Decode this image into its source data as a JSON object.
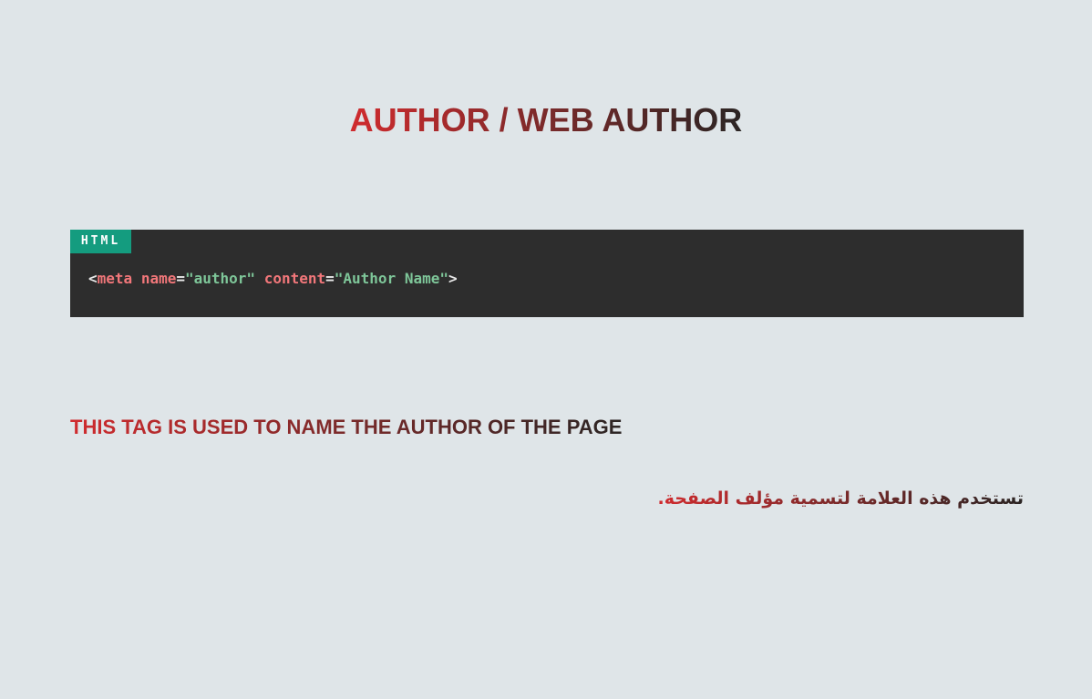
{
  "page": {
    "title": "AUTHOR / WEB AUTHOR"
  },
  "code_block": {
    "language_label": "HTML",
    "tokens": {
      "open": "<",
      "tag": "meta",
      "space1": " ",
      "attr1_name": "name",
      "eq1": "=",
      "attr1_value": "\"author\"",
      "space2": " ",
      "attr2_name": "content",
      "eq2": "=",
      "attr2_value": "\"Author Name\"",
      "close": ">"
    }
  },
  "description": {
    "english": "THIS TAG IS USED TO NAME THE AUTHOR OF THE PAGE",
    "arabic": "تستخدم هذه العلامة لتسمية مؤلف الصفحة."
  },
  "colors": {
    "background": "#dfe5e8",
    "gradient_start": "#d02b2e",
    "gradient_end": "#2b2524",
    "code_background": "#2d2d2d",
    "badge_background": "#149c7f",
    "code_tag": "#f2777a",
    "code_string": "#7ec699"
  }
}
